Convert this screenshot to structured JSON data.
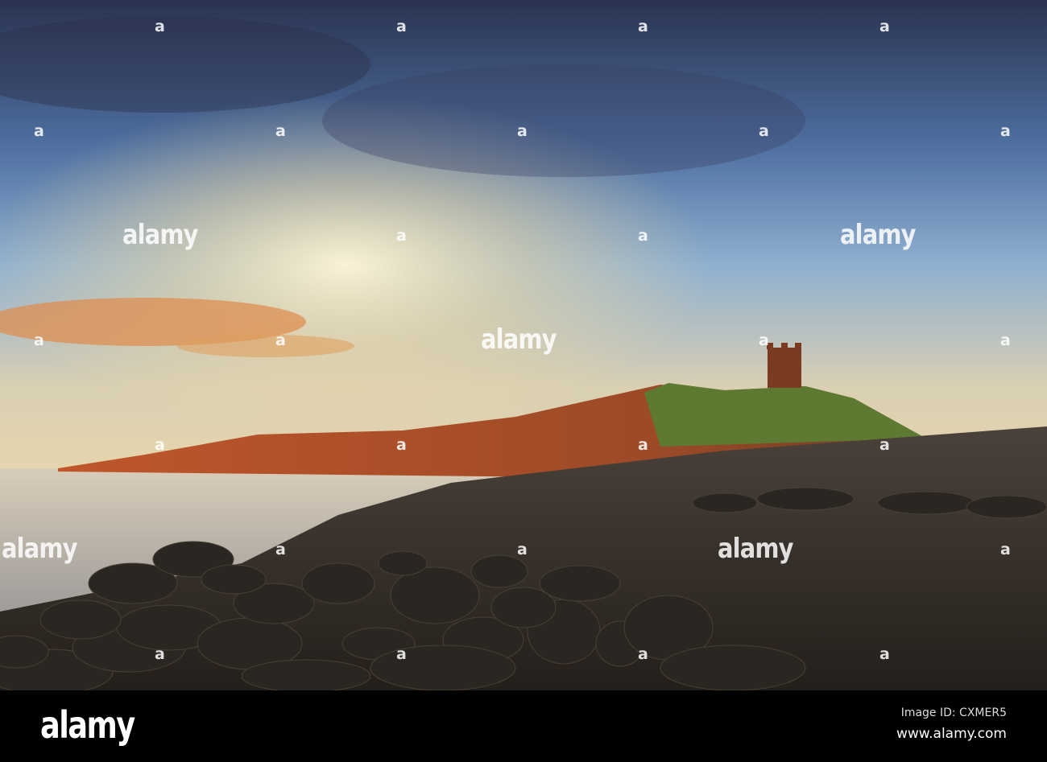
{
  "photo": {
    "subject": "Dunstanburgh Castle headland over boulder beach at sunset",
    "colors": {
      "sky_top": "#2b3656",
      "sky_mid": "#5f86b8",
      "glow": "#f6e7b8",
      "orange_cloud": "#e0884a",
      "cliff": "#b4512a",
      "grass": "#5c7a30",
      "rocks": "#1e1b18",
      "sea": "#c9c2b6"
    }
  },
  "watermarks": {
    "text": "alamy",
    "mark": "a"
  },
  "footer": {
    "logo": "alamy",
    "image_id": "Image ID: CXMER5",
    "website": "www.alamy.com"
  }
}
